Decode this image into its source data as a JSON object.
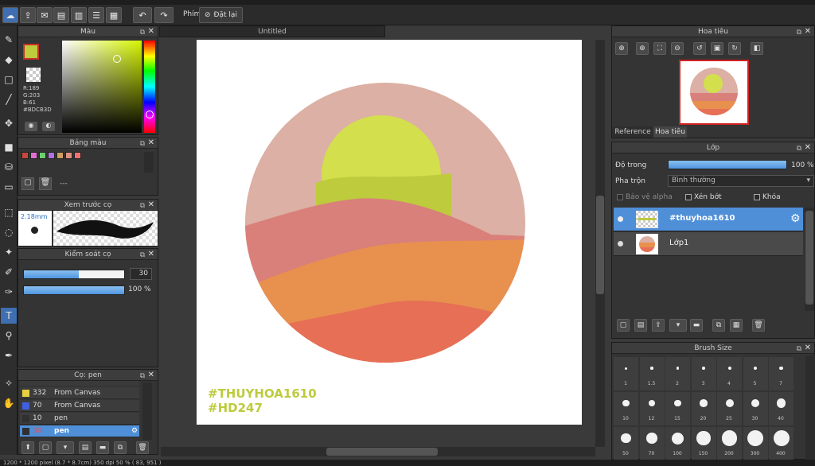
{
  "toolbar": {
    "phim_label": "Phím",
    "reset_label": "Đặt lại"
  },
  "color_panel": {
    "title": "Màu",
    "r": "R:189",
    "g": "G:203",
    "b": "B:61",
    "hex": "#BDCB3D",
    "primary": "#bdcb3d"
  },
  "palette_panel": {
    "title": "Bảng màu",
    "dash": "---",
    "swatches": [
      "#c8463c",
      "#e070d0",
      "#6cd070",
      "#b070e0",
      "#d0a060",
      "#e09080",
      "#f07070"
    ]
  },
  "preview_panel": {
    "title": "Xem trước cọ",
    "size": "2.18mm"
  },
  "brush_control": {
    "title": "Kiểm soát cọ",
    "size_value": "30",
    "opacity_value": "100 %",
    "size_fraction": 0.55,
    "opacity_fraction": 1.0
  },
  "brush_list": {
    "title": "Cọ: pen",
    "rows": [
      {
        "size": "332",
        "name": "From Canvas",
        "color": "#e8d040"
      },
      {
        "size": "70",
        "name": "From Canvas",
        "color": "#4060e0"
      },
      {
        "size": "10",
        "name": "pen",
        "color": "#303030"
      },
      {
        "size": "30",
        "name": "pen",
        "color": "#303030",
        "selected": true
      }
    ]
  },
  "document": {
    "tab": "Untitled",
    "watermark_line1": "#THUYHOA1610",
    "watermark_line2": "#HD247"
  },
  "navigator": {
    "title": "Hoa tiêu",
    "tab_reference": "Reference",
    "tab_navigator": "Hoa tiêu"
  },
  "layer_panel": {
    "title": "Lớp",
    "opacity_label": "Độ trong",
    "opacity_value": "100 %",
    "opacity_fraction": 1.0,
    "blend_label": "Pha trộn",
    "blend_value": "Bình thường",
    "protect_alpha": "Bảo vệ alpha",
    "clip": "Xén bớt",
    "lock": "Khóa",
    "layers": [
      {
        "name": "#thuyhoa1610",
        "selected": true
      },
      {
        "name": "Lớp1",
        "selected": false
      }
    ]
  },
  "brush_size_panel": {
    "title": "Brush Size",
    "sizes": [
      "1",
      "1.5",
      "2",
      "3",
      "4",
      "5",
      "7",
      "10",
      "12",
      "15",
      "20",
      "25",
      "30",
      "40",
      "50",
      "70",
      "100",
      "150",
      "200",
      "300",
      "400"
    ]
  },
  "status": {
    "text": "1200 * 1200 pixel  (8.7 * 8.7cm)  350 dpi  50 %  ( 83, 951 )"
  }
}
